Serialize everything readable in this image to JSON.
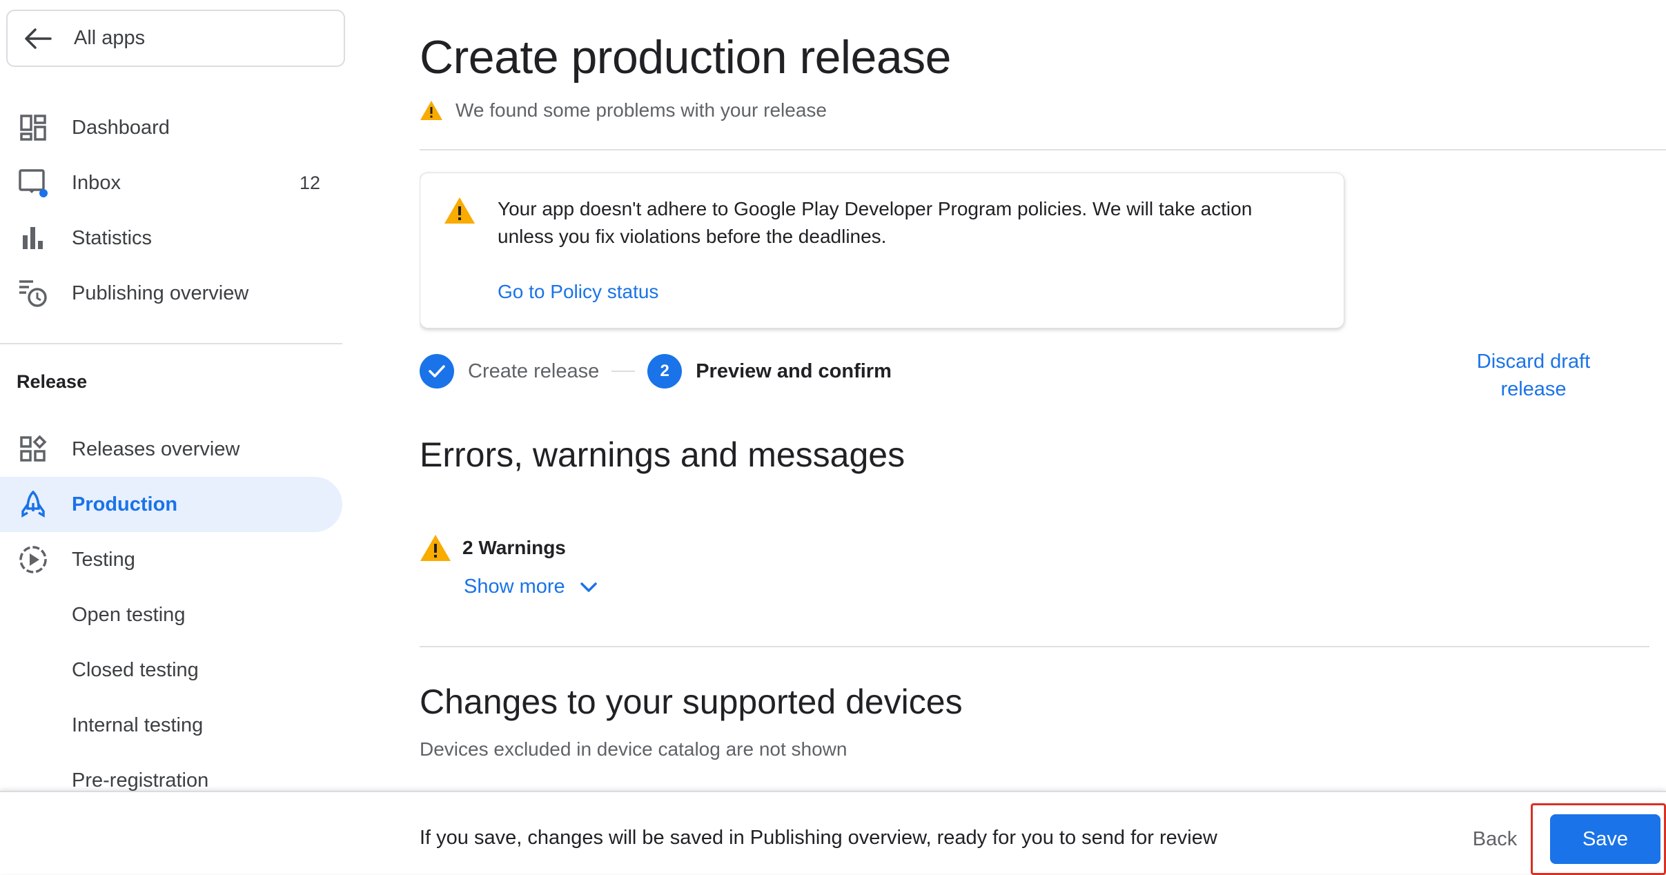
{
  "sidebar": {
    "all_apps_label": "All apps",
    "items": [
      {
        "label": "Dashboard"
      },
      {
        "label": "Inbox",
        "count": "12"
      },
      {
        "label": "Statistics"
      },
      {
        "label": "Publishing overview"
      }
    ],
    "section_title": "Release",
    "release_items": [
      {
        "label": "Releases overview"
      },
      {
        "label": "Production"
      },
      {
        "label": "Testing"
      },
      {
        "label": "Open testing"
      },
      {
        "label": "Closed testing"
      },
      {
        "label": "Internal testing"
      },
      {
        "label": "Pre-registration"
      }
    ],
    "active_item": "Production"
  },
  "main": {
    "title": "Create production release",
    "problems_text": "We found some problems with your release",
    "policy_card": {
      "message": "Your app doesn't adhere to Google Play Developer Program policies. We will take action unless you fix violations before the deadlines.",
      "link": "Go to Policy status"
    },
    "stepper": {
      "step1_label": "Create release",
      "step2_number": "2",
      "step2_label": "Preview and confirm"
    },
    "discard_label": "Discard draft release",
    "errors_heading": "Errors, warnings and messages",
    "warnings_text": "2 Warnings",
    "show_more": "Show more",
    "devices_heading": "Changes to your supported devices",
    "devices_note": "Devices excluded in device catalog are not shown"
  },
  "footer": {
    "note": "If you save, changes will be saved in Publishing overview, ready for you to send for review",
    "back_label": "Back",
    "save_label": "Save"
  },
  "colors": {
    "accent": "#1a73e8",
    "active_bg": "#e8f0fe",
    "warning": "#f9ab00",
    "highlight_border": "#d93025"
  }
}
